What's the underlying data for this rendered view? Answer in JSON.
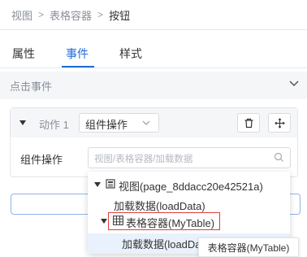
{
  "breadcrumb": [
    "视图",
    "表格容器",
    "按钮"
  ],
  "tabs": [
    {
      "label": "属性",
      "active": false
    },
    {
      "label": "事件",
      "active": true
    },
    {
      "label": "样式",
      "active": false
    }
  ],
  "section": {
    "title": "点击事件",
    "icon": "chevron-down-icon"
  },
  "action": {
    "label": "动作 1",
    "type_value": "组件操作",
    "delete_icon": "trash-icon",
    "move_icon": "move-icon"
  },
  "component_field": {
    "label": "组件操作",
    "placeholder": "视图/表格容器/加载数据",
    "icon": "search-icon"
  },
  "tree": [
    {
      "label": "视图(page_8ddacc20e42521a)",
      "icon": "page-icon",
      "expanded": true
    },
    {
      "label": "加载数据(loadData)"
    },
    {
      "label": "表格容器(MyTable)",
      "icon": "table-icon",
      "expanded": true,
      "highlighted": true
    },
    {
      "label": "加载数据(loadData)",
      "hovered": true
    }
  ],
  "tooltip": "表格容器(MyTable)",
  "colors": {
    "accent": "#1f6bdc",
    "highlight_border": "#e53935",
    "hover_bg": "#e9f1fd"
  }
}
